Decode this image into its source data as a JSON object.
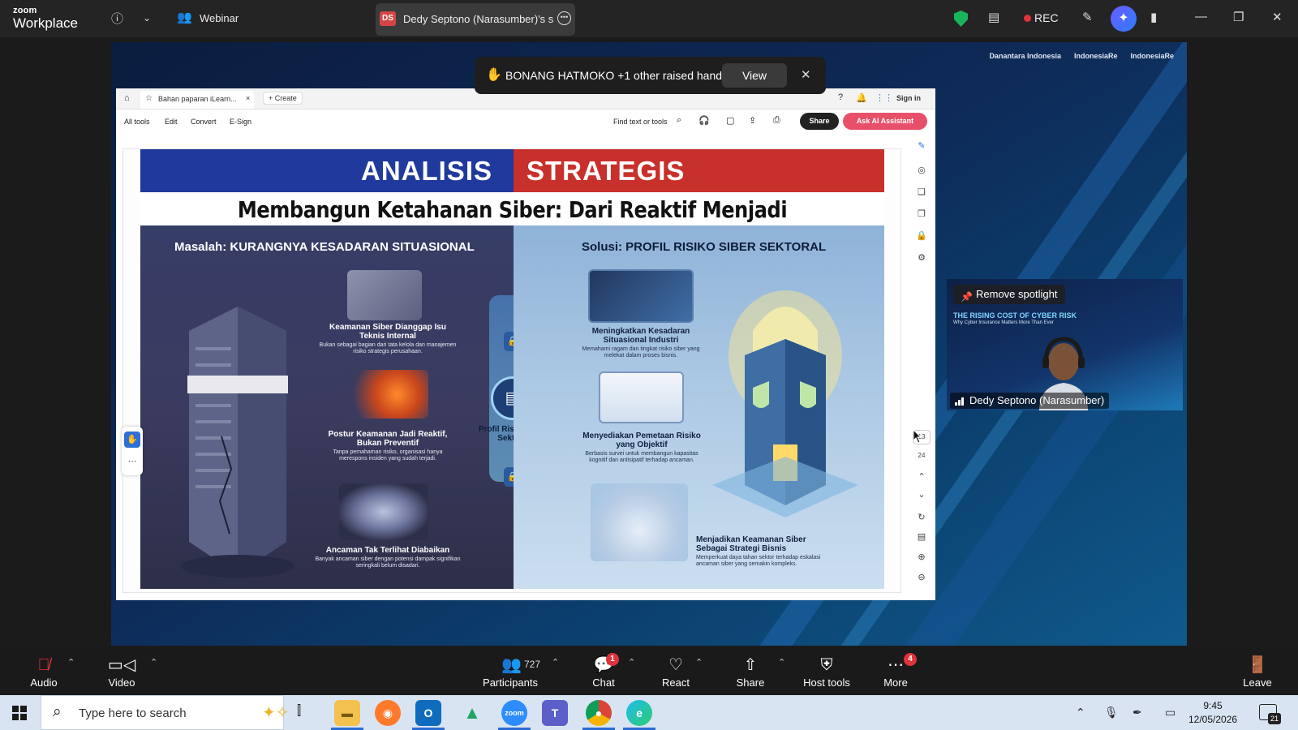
{
  "zoom": {
    "logo_small": "zoom",
    "logo_big": "Workplace",
    "meeting_type": "Webinar",
    "share_badge": "DS",
    "share_label": "Dedy Septono (Narasumber)'s screen",
    "rec_label": "REC"
  },
  "raised_hands": {
    "text": "BONANG HATMOKO +1 other raised hands",
    "view_label": "View"
  },
  "sponsor": {
    "logo1": "Danantara Indonesia",
    "logo2": "IndonesiaRe",
    "logo3": "IndonesiaRe"
  },
  "acrobat": {
    "tab_title": "Bahan paparan iLearn...",
    "create_label": "Create",
    "sign_in": "Sign in",
    "menu": [
      "All tools",
      "Edit",
      "Convert",
      "E-Sign"
    ],
    "find_label": "Find text or tools",
    "share_label": "Share",
    "ai_label": "Ask AI Assistant",
    "page_current": "13",
    "page_total": "24"
  },
  "slide": {
    "header_left": "ANALISIS",
    "header_right": "STRATEGIS",
    "subtitle": "Membangun Ketahanan Siber: Dari Reaktif Menjadi Preventif",
    "left_title": "Masalah: KURANGNYA KESADARAN SITUASIONAL",
    "right_title": "Solusi: PROFIL RISIKO SIBER SEKTORAL",
    "center_label": "Profil Risiko Siber Sektoral",
    "left_items": [
      {
        "title": "Keamanan Siber Dianggap Isu Teknis Internal",
        "desc": "Bukan sebagai bagian dari tata kelola dan manajemen risiko strategis perusahaan."
      },
      {
        "title": "Postur Keamanan Jadi Reaktif, Bukan Preventif",
        "desc": "Tanpa pemahaman risiko, organisasi hanya merespons insiden yang sudah terjadi."
      },
      {
        "title": "Ancaman Tak Terlihat Diabaikan",
        "desc": "Banyak ancaman siber dengan potensi dampak signifikan seringkali belum disadari."
      }
    ],
    "right_items": [
      {
        "title": "Meningkatkan Kesadaran Situasional Industri",
        "desc": "Memahami ragam dan tingkat risiko siber yang melekat dalam proses bisnis."
      },
      {
        "title": "Menyediakan Pemetaan Risiko yang Objektif",
        "desc": "Berbasis survei untuk membangun kapasitas kognitif dan antisipatif terhadap ancaman."
      },
      {
        "title": "Menjadikan Keamanan Siber Sebagai Strategi Bisnis",
        "desc": "Memperkuat daya tahan sektor terhadap eskalasi ancaman siber yang semakin kompleks."
      }
    ]
  },
  "spotlight": {
    "remove_label": "Remove spotlight",
    "slide_title": "THE RISING COST OF CYBER RISK",
    "slide_sub": "Why Cyber Insurance Matters More Than Ever",
    "name": "Dedy Septono (Narasumber)"
  },
  "controls": {
    "audio": "Audio",
    "video": "Video",
    "participants": "Participants",
    "participant_count": "727",
    "chat": "Chat",
    "chat_badge": "1",
    "react": "React",
    "share": "Share",
    "host_tools": "Host tools",
    "more": "More",
    "more_badge": "4",
    "leave": "Leave"
  },
  "taskbar": {
    "search_placeholder": "Type here to search",
    "time": "9:45",
    "date": "12/05/2026",
    "notif_count": "21"
  },
  "colors": {
    "zoom_dark": "#242424",
    "header_blue": "#1f3a9c",
    "header_red": "#c8302b",
    "ai_pink": "#e8506a",
    "rec_red": "#e0323b"
  }
}
